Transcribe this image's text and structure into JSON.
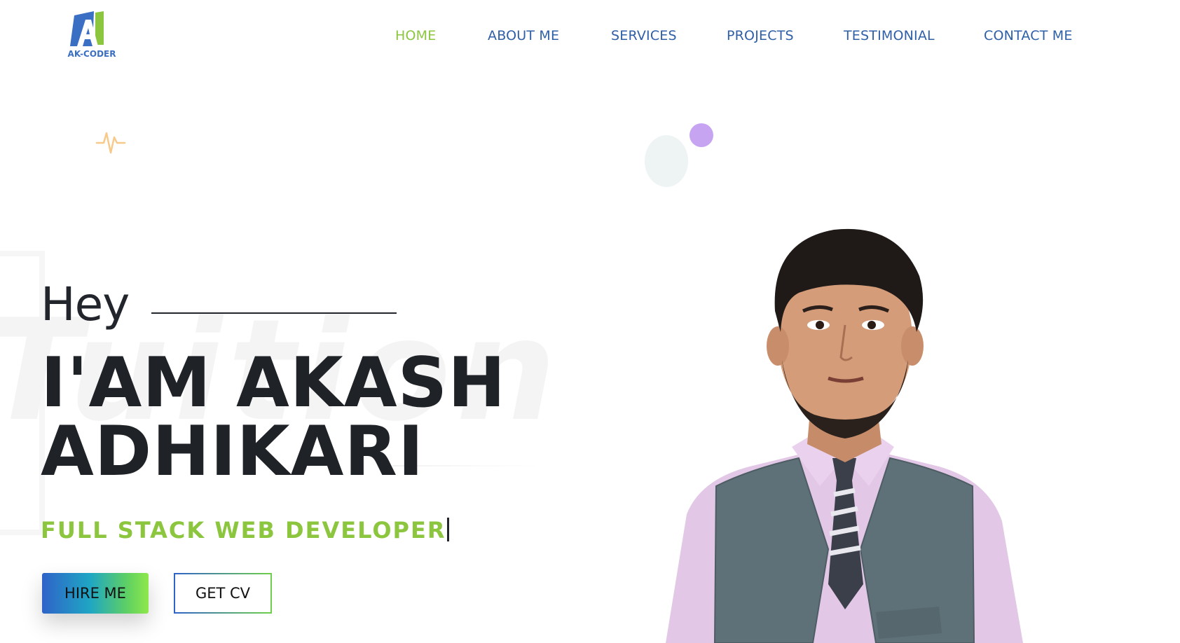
{
  "logo": {
    "mark": "A",
    "text": "AK-CODER",
    "colors": {
      "blue": "#3a6fc4",
      "green": "#8cc63f"
    }
  },
  "nav": {
    "items": [
      {
        "label": "HOME",
        "active": true
      },
      {
        "label": "ABOUT ME",
        "active": false
      },
      {
        "label": "SERVICES",
        "active": false
      },
      {
        "label": "PROJECTS",
        "active": false
      },
      {
        "label": "TESTIMONIAL",
        "active": false
      },
      {
        "label": "CONTACT ME",
        "active": false
      }
    ]
  },
  "hero": {
    "greeting": "Hey",
    "name_line1": "I'AM AKASH",
    "name_line2": "ADHIKARI",
    "role": "FULL STACK WEB DEVELOPER",
    "background_word": "Tuition",
    "hire_button": "HIRE ME",
    "cv_button": "GET CV"
  },
  "decor": {
    "pulse_icon": "heartbeat-icon",
    "colors": {
      "accent_green": "#8cc63f",
      "nav_blue": "#2f5fa7",
      "purple_dot": "#c6a4f2",
      "pulse_orange": "#f7c98a"
    }
  }
}
